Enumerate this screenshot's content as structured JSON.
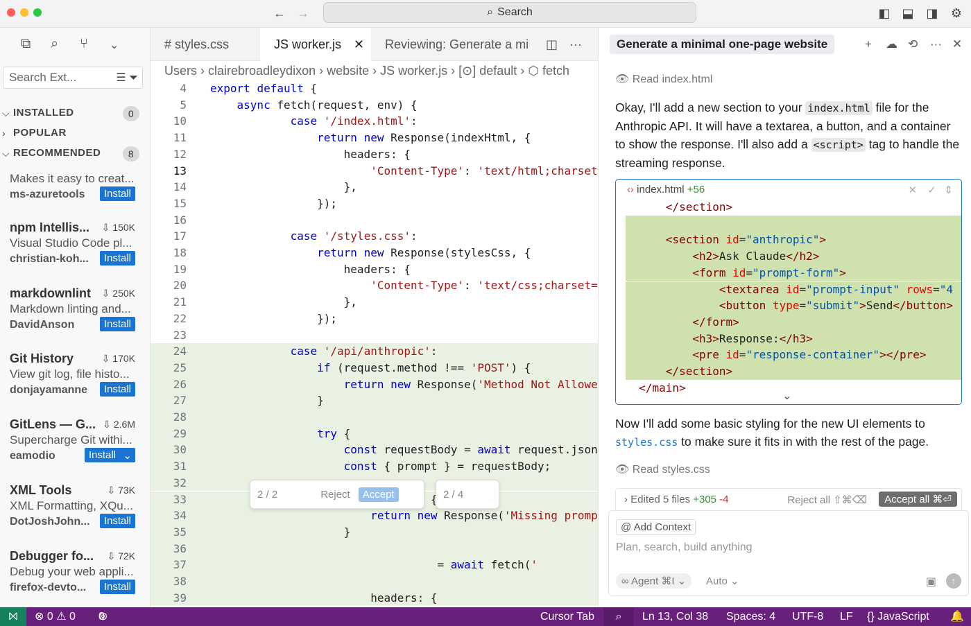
{
  "titlebar": {
    "search": "Search"
  },
  "sidebar": {
    "search_placeholder": "Search Ext...",
    "sections": [
      {
        "label": "INSTALLED",
        "count": "0"
      },
      {
        "label": "POPULAR"
      },
      {
        "label": "RECOMMENDED",
        "count": "8"
      }
    ],
    "extensions": [
      {
        "name": "",
        "downloads": "",
        "desc": "Makes it easy to creat...",
        "publisher": "ms-azuretools",
        "install": "Install"
      },
      {
        "name": "npm Intellis...",
        "downloads": "150K",
        "desc": "Visual Studio Code pl...",
        "publisher": "christian-koh...",
        "install": "Install"
      },
      {
        "name": "markdownlint",
        "downloads": "250K",
        "desc": "Markdown linting and...",
        "publisher": "DavidAnson",
        "install": "Install"
      },
      {
        "name": "Git History",
        "downloads": "170K",
        "desc": "View git log, file histo...",
        "publisher": "donjayamanne",
        "install": "Install"
      },
      {
        "name": "GitLens — G...",
        "downloads": "2.6M",
        "desc": "Supercharge Git withi...",
        "publisher": "eamodio",
        "install": "Install"
      },
      {
        "name": "XML Tools",
        "downloads": "73K",
        "desc": "XML Formatting, XQu...",
        "publisher": "DotJoshJohn...",
        "install": "Install"
      },
      {
        "name": "Debugger fo...",
        "downloads": "72K",
        "desc": "Debug your web appli...",
        "publisher": "firefox-devto...",
        "install": "Install"
      }
    ]
  },
  "tabs": [
    {
      "label": "# styles.css"
    },
    {
      "label": "JS  worker.js"
    },
    {
      "label": "Reviewing: Generate a mi"
    }
  ],
  "breadcrumb": "Users › clairebroadleydixon › website › JS worker.js › [⊙] default › ⬡ fetch",
  "editor": {
    "lines": [
      {
        "n": "4",
        "t": "export default {"
      },
      {
        "n": "5",
        "t": "    async fetch(request, env) {"
      },
      {
        "n": "10",
        "t": "            case '/index.html':"
      },
      {
        "n": "11",
        "t": "                return new Response(indexHtml, {"
      },
      {
        "n": "12",
        "t": "                    headers: {"
      },
      {
        "n": "13",
        "t": "                        'Content-Type': 'text/html;charset="
      },
      {
        "n": "14",
        "t": "                    },"
      },
      {
        "n": "15",
        "t": "                });"
      },
      {
        "n": "16",
        "t": ""
      },
      {
        "n": "17",
        "t": "            case '/styles.css':"
      },
      {
        "n": "18",
        "t": "                return new Response(stylesCss, {"
      },
      {
        "n": "19",
        "t": "                    headers: {"
      },
      {
        "n": "20",
        "t": "                        'Content-Type': 'text/css;charset=("
      },
      {
        "n": "21",
        "t": "                    },"
      },
      {
        "n": "22",
        "t": "                });"
      },
      {
        "n": "23",
        "t": ""
      },
      {
        "n": "24",
        "t": "            case '/api/anthropic':"
      },
      {
        "n": "25",
        "t": "                if (request.method !== 'POST') {"
      },
      {
        "n": "26",
        "t": "                    return new Response('Method Not Allowe"
      },
      {
        "n": "27",
        "t": "                }"
      },
      {
        "n": "28",
        "t": ""
      },
      {
        "n": "29",
        "t": "                try {"
      },
      {
        "n": "30",
        "t": "                    const requestBody = await request.json("
      },
      {
        "n": "31",
        "t": "                    const { prompt } = requestBody;"
      },
      {
        "n": "32",
        "t": ""
      },
      {
        "n": "33",
        "t": "                    if (!prompt) {"
      },
      {
        "n": "34",
        "t": "                        return new Response('Missing prompt"
      },
      {
        "n": "35",
        "t": "                    }"
      },
      {
        "n": "36",
        "t": ""
      },
      {
        "n": "37",
        "t": "                                  = await fetch('"
      },
      {
        "n": "38",
        "t": ""
      },
      {
        "n": "39",
        "t": "                        headers: {"
      }
    ],
    "diff_nav1": "2 / 2",
    "reject": "Reject",
    "accept": "Accept",
    "diff_nav2": "2 / 4"
  },
  "chat": {
    "title": "Generate a minimal one-page website",
    "read1": "Read index.html",
    "para1_a": "Okay, I'll add a new section to your ",
    "para1_code": "index.html",
    "para1_b": " file for the Anthropic API. It will have a textarea, a button, and a container to show the response. I'll also add a ",
    "para1_code2": "<script>",
    "para1_c": " tag to handle the streaming response.",
    "codebox_file": "index.html",
    "codebox_added": "+56",
    "code_lines": [
      "      </section>",
      "",
      "      <section id=\"anthropic\">",
      "          <h2>Ask Claude</h2>",
      "          <form id=\"prompt-form\">",
      "              <textarea id=\"prompt-input\" rows=\"4",
      "              <button type=\"submit\">Send</button>",
      "          </form>",
      "          <h3>Response:</h3>",
      "          <pre id=\"response-container\"></pre>",
      "      </section>",
      "  </main>"
    ],
    "para2_a": "Now I'll add some basic styling for the new UI elements to ",
    "para2_link": "styles.css",
    "para2_b": " to make sure it fits in with the rest of the page.",
    "read2": "Read styles.css",
    "edited": "Edited 5 files",
    "edited_add": "+305",
    "edited_del": "-4",
    "reject_all": "Reject all ⇧⌘⌫",
    "accept_all": "Accept all ⌘⏎",
    "add_context": "Add Context",
    "placeholder": "Plan, search, build anything",
    "agent": "Agent ⌘I",
    "auto": "Auto"
  },
  "status": {
    "errors": "⊗ 0 ⚠ 0",
    "ports": "0",
    "cursor_tab": "Cursor Tab",
    "position": "Ln 13, Col 38",
    "spaces": "Spaces: 4",
    "encoding": "UTF-8",
    "eol": "LF",
    "lang": "{} JavaScript"
  }
}
